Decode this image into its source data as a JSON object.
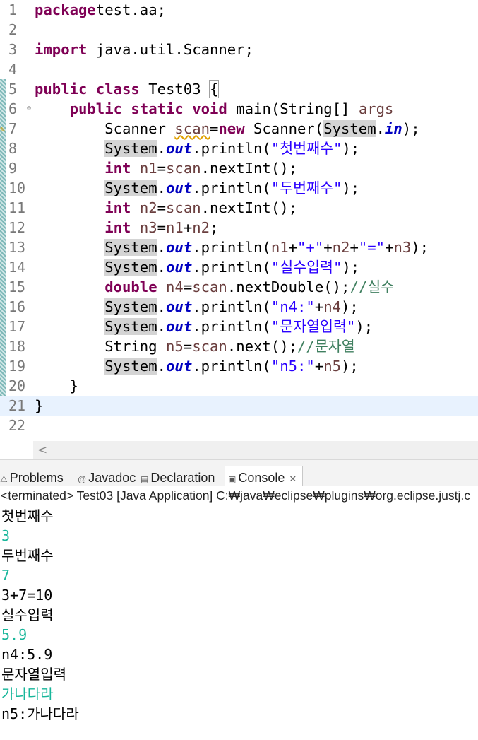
{
  "editor": {
    "lines": [
      {
        "n": "1",
        "tokens": [
          [
            "kw",
            "package"
          ],
          [
            "",
            "test.aa;"
          ]
        ]
      },
      {
        "n": "2",
        "tokens": []
      },
      {
        "n": "3",
        "tokens": [
          [
            "kw",
            "import"
          ],
          [
            "",
            " java.util.Scanner;"
          ]
        ]
      },
      {
        "n": "4",
        "tokens": []
      },
      {
        "n": "5",
        "tokens": [
          [
            "kw",
            "public"
          ],
          [
            "",
            " "
          ],
          [
            "kw",
            "class"
          ],
          [
            "",
            " Test03 "
          ],
          [
            "brace",
            "{"
          ]
        ]
      },
      {
        "n": "6",
        "fold": "⊖",
        "tokens": [
          [
            "",
            "    "
          ],
          [
            "kw",
            "public"
          ],
          [
            "",
            " "
          ],
          [
            "kw",
            "static"
          ],
          [
            "",
            " "
          ],
          [
            "kw",
            "void"
          ],
          [
            "",
            " main(String[] "
          ],
          [
            "var",
            "args"
          ],
          [
            ") {"
          ]
        ]
      },
      {
        "n": "7",
        "tokens": [
          [
            "",
            "        Scanner "
          ],
          [
            "varwarn",
            "scan"
          ],
          [
            "",
            "="
          ],
          [
            "kw",
            "new"
          ],
          [
            "",
            " Scanner("
          ],
          [
            "occ",
            "System"
          ],
          [
            "",
            "."
          ],
          [
            "fld",
            "in"
          ],
          [
            "",
            ");"
          ]
        ]
      },
      {
        "n": "8",
        "tokens": [
          [
            "",
            "        "
          ],
          [
            "occ",
            "System"
          ],
          [
            "",
            "."
          ],
          [
            "fld",
            "out"
          ],
          [
            "",
            ".println("
          ],
          [
            "str",
            "\"첫번째수\""
          ],
          [
            "",
            ");"
          ]
        ]
      },
      {
        "n": "9",
        "tokens": [
          [
            "",
            "        "
          ],
          [
            "kw",
            "int"
          ],
          [
            "",
            " "
          ],
          [
            "var",
            "n1"
          ],
          [
            "",
            "="
          ],
          [
            "var",
            "scan"
          ],
          [
            "",
            ".nextInt();"
          ]
        ]
      },
      {
        "n": "10",
        "tokens": [
          [
            "",
            "        "
          ],
          [
            "occ",
            "System"
          ],
          [
            "",
            "."
          ],
          [
            "fld",
            "out"
          ],
          [
            "",
            ".println("
          ],
          [
            "str",
            "\"두번째수\""
          ],
          [
            "",
            ");"
          ]
        ]
      },
      {
        "n": "11",
        "tokens": [
          [
            "",
            "        "
          ],
          [
            "kw",
            "int"
          ],
          [
            "",
            " "
          ],
          [
            "var",
            "n2"
          ],
          [
            "",
            "="
          ],
          [
            "var",
            "scan"
          ],
          [
            "",
            ".nextInt();"
          ]
        ]
      },
      {
        "n": "12",
        "tokens": [
          [
            "",
            "        "
          ],
          [
            "kw",
            "int"
          ],
          [
            "",
            " "
          ],
          [
            "var",
            "n3"
          ],
          [
            "",
            "="
          ],
          [
            "var",
            "n1"
          ],
          [
            "",
            "+"
          ],
          [
            "var",
            "n2"
          ],
          [
            "",
            ";"
          ]
        ]
      },
      {
        "n": "13",
        "tokens": [
          [
            "",
            "        "
          ],
          [
            "occ",
            "System"
          ],
          [
            "",
            "."
          ],
          [
            "fld",
            "out"
          ],
          [
            "",
            ".println("
          ],
          [
            "var",
            "n1"
          ],
          [
            "",
            "+"
          ],
          [
            "str",
            "\"+\""
          ],
          [
            "",
            "+"
          ],
          [
            "var",
            "n2"
          ],
          [
            "",
            "+"
          ],
          [
            "str",
            "\"=\""
          ],
          [
            "",
            "+"
          ],
          [
            "var",
            "n3"
          ],
          [
            "",
            ");"
          ]
        ]
      },
      {
        "n": "14",
        "tokens": [
          [
            "",
            "        "
          ],
          [
            "occ",
            "System"
          ],
          [
            "",
            "."
          ],
          [
            "fld",
            "out"
          ],
          [
            "",
            ".println("
          ],
          [
            "str",
            "\"실수입력\""
          ],
          [
            "",
            ");"
          ]
        ]
      },
      {
        "n": "15",
        "tokens": [
          [
            "",
            "        "
          ],
          [
            "kw",
            "double"
          ],
          [
            "",
            " "
          ],
          [
            "var",
            "n4"
          ],
          [
            "",
            "="
          ],
          [
            "var",
            "scan"
          ],
          [
            "",
            ".nextDouble();"
          ],
          [
            "cmt",
            "//실수"
          ]
        ]
      },
      {
        "n": "16",
        "tokens": [
          [
            "",
            "        "
          ],
          [
            "occ",
            "System"
          ],
          [
            "",
            "."
          ],
          [
            "fld",
            "out"
          ],
          [
            "",
            ".println("
          ],
          [
            "str",
            "\"n4:\""
          ],
          [
            "",
            "+"
          ],
          [
            "var",
            "n4"
          ],
          [
            "",
            ");"
          ]
        ]
      },
      {
        "n": "17",
        "tokens": [
          [
            "",
            "        "
          ],
          [
            "occ",
            "System"
          ],
          [
            "",
            "."
          ],
          [
            "fld",
            "out"
          ],
          [
            "",
            ".println("
          ],
          [
            "str",
            "\"문자열입력\""
          ],
          [
            "",
            ");"
          ]
        ]
      },
      {
        "n": "18",
        "tokens": [
          [
            "",
            "        String "
          ],
          [
            "var",
            "n5"
          ],
          [
            "",
            "="
          ],
          [
            "var",
            "scan"
          ],
          [
            "",
            ".next();"
          ],
          [
            "cmt",
            "//문자열"
          ]
        ]
      },
      {
        "n": "19",
        "tokens": [
          [
            "",
            "        "
          ],
          [
            "occ",
            "System"
          ],
          [
            "",
            "."
          ],
          [
            "fld",
            "out"
          ],
          [
            "",
            ".println("
          ],
          [
            "str",
            "\"n5:\""
          ],
          [
            "",
            "+"
          ],
          [
            "var",
            "n5"
          ],
          [
            "",
            ");"
          ]
        ]
      },
      {
        "n": "20",
        "tokens": [
          [
            "",
            "    }"
          ]
        ]
      },
      {
        "n": "21",
        "current": true,
        "tokens": [
          [
            "",
            "}"
          ]
        ]
      },
      {
        "n": "22",
        "tokens": []
      }
    ],
    "scroll_left_glyph": "<"
  },
  "views": {
    "tabs": [
      {
        "label": "Problems",
        "icon": "problems-icon",
        "glyph": "⚠"
      },
      {
        "label": "Javadoc",
        "icon": "javadoc-icon",
        "glyph": "@"
      },
      {
        "label": "Declaration",
        "icon": "declaration-icon",
        "glyph": "▤"
      },
      {
        "label": "Console",
        "icon": "console-icon",
        "glyph": "▣",
        "active": true
      }
    ],
    "close_glyph": "✕"
  },
  "console": {
    "header": "<terminated> Test03 [Java Application] C:₩java₩eclipse₩plugins₩org.eclipse.justj.c",
    "lines": [
      {
        "text": "첫번째수",
        "kind": "std"
      },
      {
        "text": "3",
        "kind": "in"
      },
      {
        "text": "두번째수",
        "kind": "std"
      },
      {
        "text": "7",
        "kind": "in"
      },
      {
        "text": "3+7=10",
        "kind": "std"
      },
      {
        "text": "실수입력",
        "kind": "std"
      },
      {
        "text": "5.9",
        "kind": "in"
      },
      {
        "text": "n4:5.9",
        "kind": "std"
      },
      {
        "text": "문자열입력",
        "kind": "std"
      },
      {
        "text": "가나다라",
        "kind": "in"
      },
      {
        "text": "n5:가나다라",
        "kind": "std"
      }
    ]
  },
  "colors": {
    "keyword": "#7f0055",
    "string": "#2a00ff",
    "field": "#0000c0",
    "local_var": "#6a3e3e",
    "comment": "#3f7f5f",
    "console_input": "#17b69a"
  }
}
